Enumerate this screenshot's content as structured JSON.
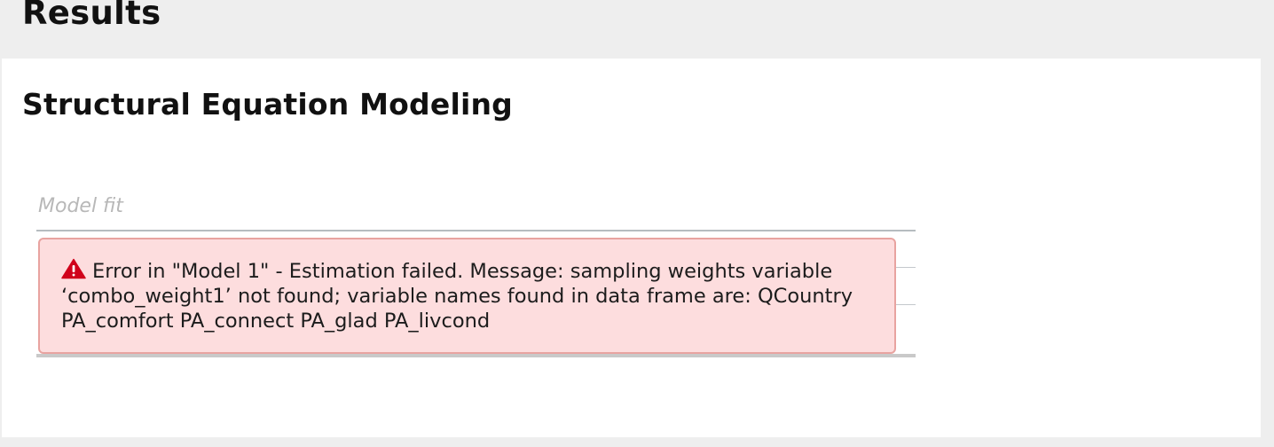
{
  "header": {
    "title": "Results"
  },
  "analysis": {
    "title": "Structural Equation Modeling",
    "table": {
      "caption": "Model fit"
    },
    "error": {
      "icon": "warning-triangle-icon",
      "message": "Error in \"Model 1\" - Estimation failed. Message: sampling weights variable ‘combo_weight1’ not found; variable names found in data frame are: QCountry PA_comfort PA_connect PA_glad PA_livcond"
    }
  },
  "colors": {
    "page_background": "#eeeeee",
    "panel_background": "#ffffff",
    "error_background": "#fdddde",
    "error_border": "#e8a3a0",
    "warning_icon": "#d0021b"
  }
}
